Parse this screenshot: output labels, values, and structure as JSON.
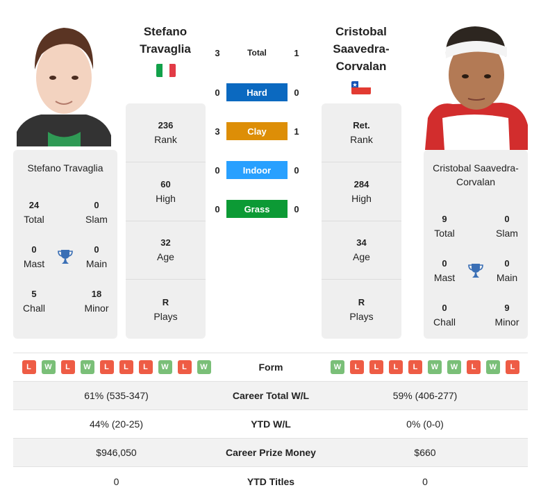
{
  "colors": {
    "hard": "#0b69c0",
    "clay": "#dd8e07",
    "indoor": "#28a0ff",
    "grass": "#0c9a35",
    "win": "#7abf78",
    "loss": "#ee5c45",
    "trophy": "#3a6fb5"
  },
  "player1": {
    "name": "Stefano Travaglia",
    "flag": "Italy",
    "photo_alt": "Stefano Travaglia photo",
    "stats": [
      {
        "value": "236",
        "label": "Rank"
      },
      {
        "value": "60",
        "label": "High"
      },
      {
        "value": "32",
        "label": "Age"
      },
      {
        "value": "R",
        "label": "Plays"
      }
    ],
    "titles": {
      "total": {
        "value": "24",
        "label": "Total"
      },
      "slam": {
        "value": "0",
        "label": "Slam"
      },
      "mast": {
        "value": "0",
        "label": "Mast"
      },
      "main": {
        "value": "0",
        "label": "Main"
      },
      "chall": {
        "value": "5",
        "label": "Chall"
      },
      "minor": {
        "value": "18",
        "label": "Minor"
      }
    },
    "form": [
      "L",
      "W",
      "L",
      "W",
      "L",
      "L",
      "L",
      "W",
      "L",
      "W"
    ]
  },
  "player2": {
    "name": "Cristobal Saavedra-Corvalan",
    "flag": "Chile",
    "photo_alt": "Cristobal Saavedra-Corvalan photo",
    "stats": [
      {
        "value": "Ret.",
        "label": "Rank"
      },
      {
        "value": "284",
        "label": "High"
      },
      {
        "value": "34",
        "label": "Age"
      },
      {
        "value": "R",
        "label": "Plays"
      }
    ],
    "titles": {
      "total": {
        "value": "9",
        "label": "Total"
      },
      "slam": {
        "value": "0",
        "label": "Slam"
      },
      "mast": {
        "value": "0",
        "label": "Mast"
      },
      "main": {
        "value": "0",
        "label": "Main"
      },
      "chall": {
        "value": "0",
        "label": "Chall"
      },
      "minor": {
        "value": "9",
        "label": "Minor"
      }
    },
    "form": [
      "W",
      "L",
      "L",
      "L",
      "L",
      "W",
      "W",
      "L",
      "W",
      "L"
    ]
  },
  "h2h": [
    {
      "label": "Total",
      "p1": "3",
      "p2": "1",
      "surface": "total"
    },
    {
      "label": "Hard",
      "p1": "0",
      "p2": "0",
      "surface": "hard"
    },
    {
      "label": "Clay",
      "p1": "3",
      "p2": "1",
      "surface": "clay"
    },
    {
      "label": "Indoor",
      "p1": "0",
      "p2": "0",
      "surface": "indoor"
    },
    {
      "label": "Grass",
      "p1": "0",
      "p2": "0",
      "surface": "grass"
    }
  ],
  "comparison": {
    "form_label": "Form",
    "rows": [
      {
        "label": "Career Total W/L",
        "p1": "61% (535-347)",
        "p2": "59% (406-277)"
      },
      {
        "label": "YTD W/L",
        "p1": "44% (20-25)",
        "p2": "0% (0-0)"
      },
      {
        "label": "Career Prize Money",
        "p1": "$946,050",
        "p2": "$660"
      },
      {
        "label": "YTD Titles",
        "p1": "0",
        "p2": "0"
      }
    ]
  }
}
